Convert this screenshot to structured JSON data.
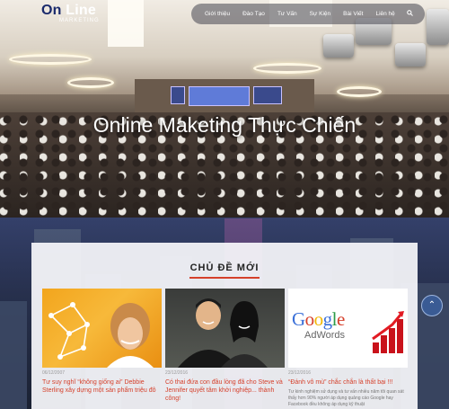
{
  "logo": {
    "main_a": "On",
    "main_b": " Line",
    "sub": "MARKETING"
  },
  "nav": {
    "items": [
      "Giới thiệu",
      "Đào Tạo",
      "Tư Vấn",
      "Sự Kiện",
      "Bài Viết",
      "Liên hệ"
    ],
    "search_icon": "search-icon"
  },
  "hero": {
    "title": "Online Maketing Thực Chiến"
  },
  "section": {
    "title": "CHỦ ĐỀ MỚI"
  },
  "posts": [
    {
      "date": "06/12/2007",
      "title": "Tư suy nghĩ “không giống ai” Debbie Sterling xây dựng một sản phẩm triệu đô",
      "excerpt": ""
    },
    {
      "date": "23/12/2016",
      "title": "Có thai đứa con đầu lòng đã cho Steve và Jennifer quyết tâm khởi nghiệp... thành công!",
      "excerpt": ""
    },
    {
      "date": "23/12/2016",
      "title": "“Đánh vô mù” chắc chắn là thất bại !!!",
      "excerpt": "Tư kinh nghiệm sử dụng và tư vấn nhiều năm tôi quan sát thấy hơn 90% người áp dụng quảng cáo Google hay Facebook đều không áp dụng kỹ thuật"
    }
  ],
  "google_ad": {
    "brand": "Google",
    "sub": "AdWords"
  },
  "scroll_top_icon": "chevron-up-icon"
}
